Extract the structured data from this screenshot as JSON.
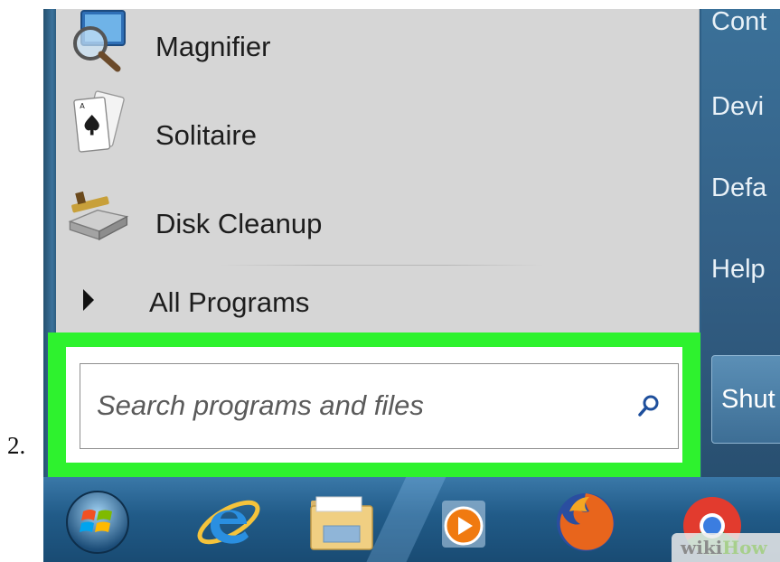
{
  "step": {
    "number": "2."
  },
  "start_menu": {
    "programs": [
      {
        "label": "Magnifier",
        "icon": "magnifier-icon"
      },
      {
        "label": "Solitaire",
        "icon": "solitaire-icon"
      },
      {
        "label": "Disk Cleanup",
        "icon": "disk-cleanup-icon"
      }
    ],
    "all_programs": {
      "label": "All Programs",
      "icon": "arrow-right-icon"
    },
    "search": {
      "placeholder": "Search programs and files",
      "value": "",
      "icon": "search-icon"
    },
    "right_pane": {
      "items": [
        "Cont",
        "Devi",
        "Defa",
        "Help"
      ],
      "shutdown_label": "Shut"
    }
  },
  "taskbar": {
    "items": [
      {
        "name": "start-orb",
        "icon": "windows-logo-icon"
      },
      {
        "name": "internet-explorer",
        "icon": "internet-explorer-icon"
      },
      {
        "name": "windows-explorer",
        "icon": "folder-icon"
      },
      {
        "name": "media-player",
        "icon": "media-player-icon"
      },
      {
        "name": "firefox",
        "icon": "firefox-icon"
      },
      {
        "name": "chrome",
        "icon": "chrome-icon"
      }
    ]
  },
  "watermark": {
    "part1": "wiki",
    "part2": "How"
  },
  "colors": {
    "highlight": "#2ef22e",
    "left_pane": "#d6d6d6",
    "right_pane": "#335f85",
    "taskbar": "#215b88"
  }
}
